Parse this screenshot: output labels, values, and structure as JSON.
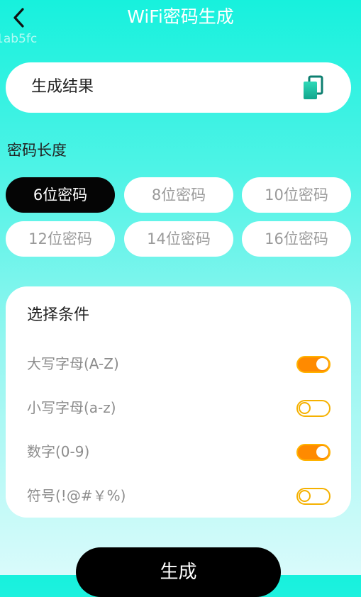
{
  "header": {
    "title": "WiFi密码生成",
    "ghost_text": "1ab5fc"
  },
  "result": {
    "text": "生成结果"
  },
  "length": {
    "label": "密码长度",
    "options": [
      {
        "label": "6位密码",
        "selected": true
      },
      {
        "label": "8位密码",
        "selected": false
      },
      {
        "label": "10位密码",
        "selected": false
      },
      {
        "label": "12位密码",
        "selected": false
      },
      {
        "label": "14位密码",
        "selected": false
      },
      {
        "label": "16位密码",
        "selected": false
      }
    ]
  },
  "conditions": {
    "title": "选择条件",
    "items": [
      {
        "label": "大写字母(A-Z)",
        "on": true
      },
      {
        "label": "小写字母(a-z)",
        "on": false
      },
      {
        "label": "数字(0-9)",
        "on": true
      },
      {
        "label": "符号(!@#￥%)",
        "on": false
      }
    ]
  },
  "generate": {
    "label": "生成"
  },
  "colors": {
    "accent": "#ff8a00",
    "toggle_border": "#f5b100",
    "background_top": "#17f1dd",
    "selected_pill": "#050505"
  },
  "icons": {
    "back": "chevron-left-icon",
    "copy": "copy-icon"
  }
}
